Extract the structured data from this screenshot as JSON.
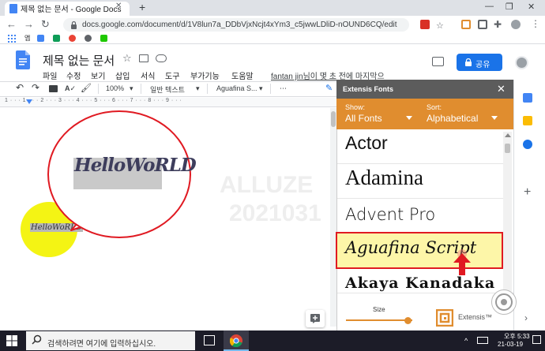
{
  "browser": {
    "tab_title": "제목 없는 문서 - Google Docs",
    "url": "docs.google.com/document/d/1V8lun7a_DDbVjxNcjt4xYm3_c5jwwLDliD-nOUND6CQ/edit",
    "bookmark_apps_label": "앱"
  },
  "docs": {
    "title": "제목 없는 문서",
    "menu": [
      "파일",
      "수정",
      "보기",
      "삽입",
      "서식",
      "도구",
      "부가기능",
      "도움말"
    ],
    "last_edit": "fantan jin님이 몇 초 전에 마지막으",
    "share_label": "공유",
    "toolbar": {
      "zoom": "100%",
      "style": "일반 텍스트",
      "font": "Aguafina S..."
    },
    "ruler_numbers": "1 · · · 1 · · · 2 · · · 3 · · · 4 · · · 5 · · · 6 · · · 7 · · · 8 · · · 9 · · ·",
    "watermark_line1": "ALLUZE",
    "watermark_line2": "2021031",
    "zoom_text": "HelloWoRLD",
    "doc_text": "HelloWoRLD"
  },
  "extensis": {
    "title": "Extensis Fonts",
    "show_label": "Show:",
    "show_value": "All Fonts",
    "sort_label": "Sort:",
    "sort_value": "Alphabetical",
    "fonts": [
      {
        "name": "Actor"
      },
      {
        "name": "Adamina"
      },
      {
        "name": "Advent Pro"
      },
      {
        "name": "Aguafina Script"
      },
      {
        "name": "Akaya Kanadaka"
      }
    ],
    "size_label": "Size",
    "size_level": 0.93,
    "brand": "Extensis™"
  },
  "taskbar": {
    "search_placeholder": "검색하려면 여기에 입력하십시오.",
    "time": "오후 5:33",
    "date": "21-03-19"
  },
  "colors": {
    "accent_orange": "#e08d2f",
    "highlight_red": "#e01a22",
    "share_blue": "#1a73e8",
    "yellow_marker": "#f4f414"
  }
}
